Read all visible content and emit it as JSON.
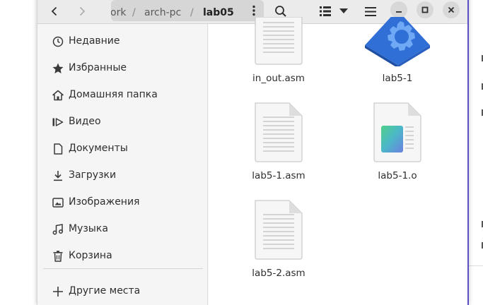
{
  "toolbar": {
    "back_icon": "chevron-left-icon",
    "forward_icon": "chevron-right-icon",
    "breadcrumbs": [
      "ork",
      "arch-pc",
      "lab05"
    ],
    "separator": "/",
    "menu_icon": "vertical-dots-icon",
    "search_icon": "search-icon",
    "view_icon": "list-view-icon",
    "view_options_icon": "triangle-down-icon",
    "main_menu_icon": "hamburger-icon",
    "minimize_icon": "minimize-icon",
    "maximize_icon": "maximize-icon",
    "close_icon": "close-icon"
  },
  "sidebar": {
    "items": [
      {
        "label": "Недавние",
        "icon": "clock-icon"
      },
      {
        "label": "Избранные",
        "icon": "star-icon"
      },
      {
        "label": "Домашняя папка",
        "icon": "home-icon"
      },
      {
        "label": "Видео",
        "icon": "video-icon"
      },
      {
        "label": "Документы",
        "icon": "document-icon"
      },
      {
        "label": "Загрузки",
        "icon": "download-icon"
      },
      {
        "label": "Изображения",
        "icon": "image-icon"
      },
      {
        "label": "Музыка",
        "icon": "music-icon"
      },
      {
        "label": "Корзина",
        "icon": "trash-icon"
      }
    ],
    "other_places": {
      "label": "Другие места",
      "icon": "plus-icon"
    }
  },
  "files": [
    {
      "name": "in_out.asm",
      "icon": "text-file-icon"
    },
    {
      "name": "lab5-1",
      "icon": "executable-gear-icon"
    },
    {
      "name": "lab5-1.asm",
      "icon": "text-file-icon"
    },
    {
      "name": "lab5-1.o",
      "icon": "object-file-icon"
    },
    {
      "name": "lab5-2.asm",
      "icon": "text-file-icon"
    }
  ],
  "colors": {
    "accent_border": "#5b4fc9",
    "gear_blue": "#2f6fd6",
    "headerbar": "#ebebeb",
    "sidebar": "#f5f5f5"
  }
}
